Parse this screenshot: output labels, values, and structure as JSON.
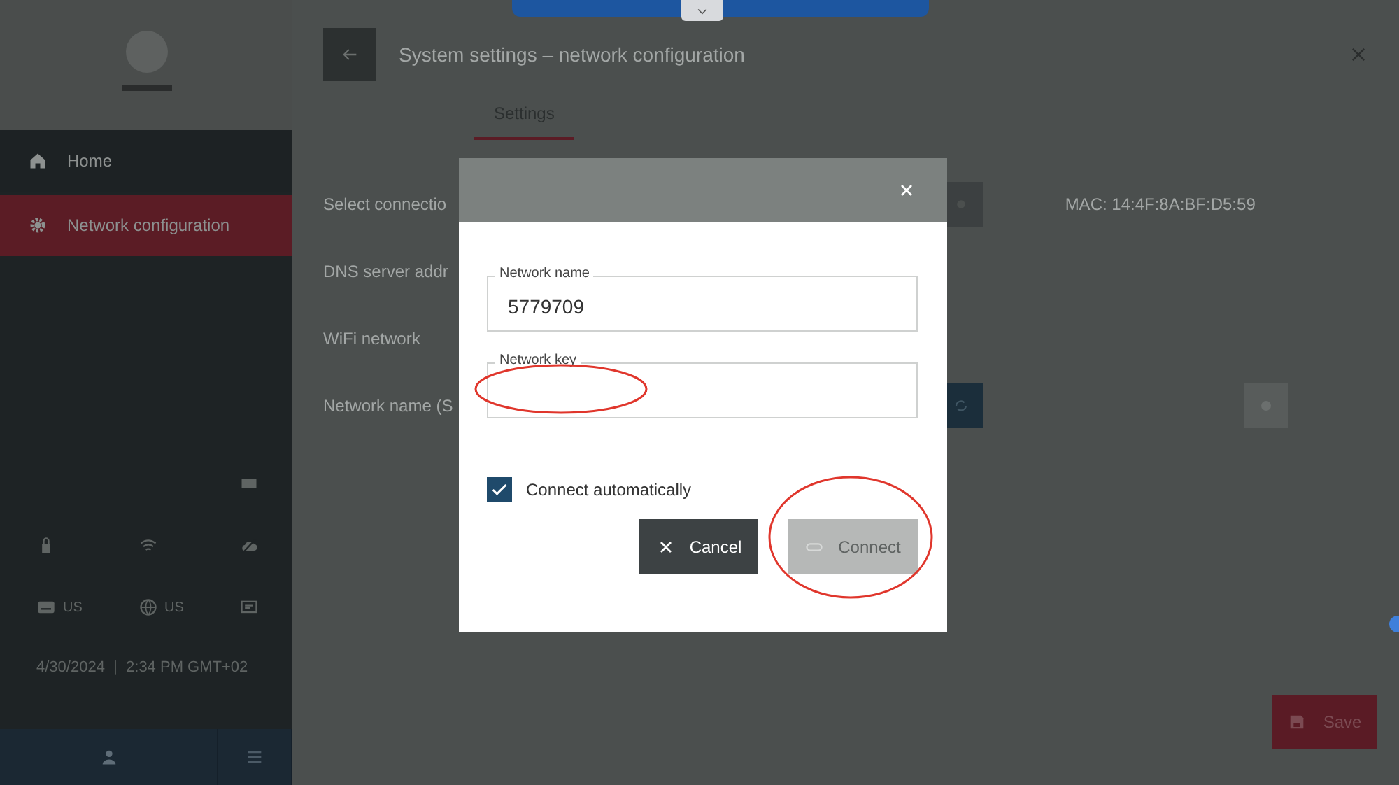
{
  "remote_toolbar": {
    "expanded": false
  },
  "sidebar": {
    "menu": [
      {
        "label": "Home",
        "selected": false
      },
      {
        "label": "Network configuration",
        "selected": true
      }
    ],
    "locale": [
      {
        "label": "US"
      },
      {
        "label": "US"
      }
    ],
    "datetime": "4/30/2024  |  2:34 PM GMT+02"
  },
  "header": {
    "title": "System settings – network configuration"
  },
  "tabs": [
    {
      "label": "Settings",
      "selected": true
    }
  ],
  "rows": [
    {
      "label": "Select connectio",
      "value": "MAC: 14:4F:8A:BF:D5:59"
    },
    {
      "label": "DNS server addr"
    },
    {
      "label": "WiFi network"
    },
    {
      "label": "Network name (S"
    }
  ],
  "save_button": "Save",
  "dialog": {
    "fields": [
      {
        "label": "Network name",
        "value": "5779709"
      },
      {
        "label": "Network key"
      }
    ],
    "checkbox": {
      "label": "Connect automatically",
      "checked": true
    },
    "buttons": [
      {
        "label": "Cancel",
        "kind": "cancel",
        "disabled": false
      },
      {
        "label": "Connect",
        "kind": "connect",
        "disabled": true
      }
    ]
  }
}
